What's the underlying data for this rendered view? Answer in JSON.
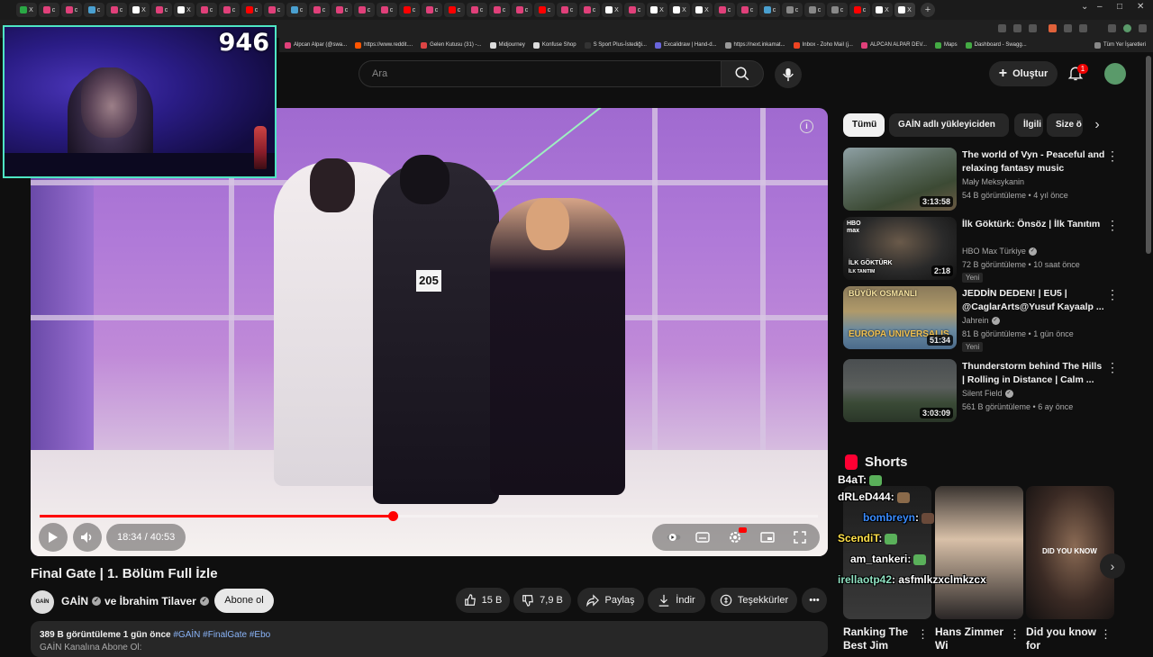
{
  "browser": {
    "tabs": [
      {
        "glyph": "X",
        "color": "#2aa845"
      },
      {
        "glyph": "c",
        "color": "#e0407a"
      },
      {
        "glyph": "c",
        "color": "#e0407a"
      },
      {
        "glyph": "c",
        "color": "#4aa0d0"
      },
      {
        "glyph": "c",
        "color": "#e0407a"
      },
      {
        "glyph": "X",
        "color": "#ffffff"
      },
      {
        "glyph": "c",
        "color": "#e0407a"
      },
      {
        "glyph": "X",
        "color": "#ffffff"
      },
      {
        "glyph": "c",
        "color": "#e0407a"
      },
      {
        "glyph": "c",
        "color": "#e0407a"
      },
      {
        "glyph": "c",
        "color": "#ff0000"
      },
      {
        "glyph": "c",
        "color": "#e0407a"
      },
      {
        "glyph": "c",
        "color": "#4aa0d0"
      },
      {
        "glyph": "c",
        "color": "#e0407a"
      },
      {
        "glyph": "c",
        "color": "#e0407a"
      },
      {
        "glyph": "c",
        "color": "#e0407a"
      },
      {
        "glyph": "c",
        "color": "#e0407a"
      },
      {
        "glyph": "c",
        "color": "#ff0000"
      },
      {
        "glyph": "c",
        "color": "#e0407a"
      },
      {
        "glyph": "c",
        "color": "#ff0000"
      },
      {
        "glyph": "c",
        "color": "#e0407a"
      },
      {
        "glyph": "c",
        "color": "#e0407a"
      },
      {
        "glyph": "c",
        "color": "#e0407a"
      },
      {
        "glyph": "c",
        "color": "#ff0000"
      },
      {
        "glyph": "c",
        "color": "#e0407a"
      },
      {
        "glyph": "c",
        "color": "#e0407a"
      },
      {
        "glyph": "X",
        "color": "#ffffff"
      },
      {
        "glyph": "c",
        "color": "#e0407a"
      },
      {
        "glyph": "X",
        "color": "#ffffff"
      },
      {
        "glyph": "X",
        "color": "#ffffff"
      },
      {
        "glyph": "X",
        "color": "#ffffff"
      },
      {
        "glyph": "c",
        "color": "#e0407a"
      },
      {
        "glyph": "c",
        "color": "#e0407a"
      },
      {
        "glyph": "c",
        "color": "#4aa0d0"
      },
      {
        "glyph": "c",
        "color": "#888888"
      },
      {
        "glyph": "c",
        "color": "#888888"
      },
      {
        "glyph": "c",
        "color": "#888888"
      },
      {
        "glyph": "c",
        "color": "#ff0000"
      },
      {
        "glyph": "X",
        "color": "#ffffff"
      },
      {
        "glyph": "X",
        "color": "#ffffff"
      }
    ],
    "bookmarks": [
      {
        "label": "Alpcan Alpar (@swa...",
        "color": "#e0407a"
      },
      {
        "label": "https://www.reddit....",
        "color": "#ff5500"
      },
      {
        "label": "Gelen Kutusu (31) -...",
        "color": "#d44"
      },
      {
        "label": "Midjourney",
        "color": "#ddd"
      },
      {
        "label": "Konfuse Shop",
        "color": "#ddd"
      },
      {
        "label": "S Sport Plus-İstediği...",
        "color": "#333"
      },
      {
        "label": "Excalidraw | Hand-d...",
        "color": "#6965db"
      },
      {
        "label": "https://next.inkamat...",
        "color": "#999"
      },
      {
        "label": "Inbox - Zoho Mail (j...",
        "color": "#e42"
      },
      {
        "label": "ALPCAN ALPAR DEV...",
        "color": "#e0407a"
      },
      {
        "label": "Maps",
        "color": "#4a4"
      },
      {
        "label": "Dashboard - Swagg...",
        "color": "#4a4"
      }
    ],
    "all_bookmarks": "Tüm Yer İşaretleri"
  },
  "webcam": {
    "counter": "946"
  },
  "header": {
    "search_placeholder": "Ara",
    "create_label": "Oluştur",
    "notif_count": "1"
  },
  "player": {
    "time": "18:34 / 40:53",
    "progress": 0.4537,
    "bib_number": "205"
  },
  "video": {
    "title": "Final Gate | 1. Bölüm Full İzle",
    "channel_avatar": "GAİN",
    "channel": "GAİN",
    "collab": "ve İbrahim Tilaver",
    "subscribe": "Abone ol",
    "likes": "15 B",
    "dislikes": "7,9 B",
    "share": "Paylaş",
    "download": "İndir",
    "thanks": "Teşekkürler",
    "views_date": "389 B görüntüleme  1 gün önce",
    "tags": "#GAİN #FinalGate #Ebo",
    "desc_line2": "GAİN Kanalına Abone Ol:"
  },
  "chips": [
    "Tümü",
    "GAİN adlı yükleyiciden",
    "İlgili",
    "Size ö"
  ],
  "recommendations": [
    {
      "title": "The world of Vyn - Peaceful and relaxing fantasy music (Enderal)",
      "channel": "Mały Meksykanin",
      "verified": false,
      "meta": "54 B görüntüleme • 4 yıl önce",
      "duration": "3:13:58",
      "new": "",
      "bg": "linear-gradient(160deg,#8ea0a4 0%,#5a6a5e 40%,#3c4a34 70%,#6a5a44 100%)"
    },
    {
      "title": "İlk Göktürk: Önsöz | İlk Tanıtım",
      "channel": "HBO Max Türkiye",
      "verified": true,
      "meta": "72 B görüntüleme • 10 saat önce",
      "duration": "2:18",
      "new": "Yeni",
      "bg": "radial-gradient(ellipse at 50% 40%,#6a5a4a 0%,#2a2a2a 55%,#111 100%)",
      "caption": "İLK GÖKTÜRK",
      "caption2": "İLK TANITIM"
    },
    {
      "title": "JEDDİN DEDEN! | EU5 | @CaglarArts@Yusuf Kayaalp ...",
      "channel": "Jahrein",
      "verified": true,
      "meta": "81 B görüntüleme • 1 gün önce",
      "duration": "51:34",
      "new": "Yeni",
      "bg": "linear-gradient(180deg,#8a7a5a 0%,#b09a6a 40%,#6a8aa0 70%,#4a6a8a 100%)",
      "caption": "BÜYÜK OSMANLI",
      "caption2": "EUROPA UNIVERSALIS"
    },
    {
      "title": "Thunderstorm behind The Hills | Rolling in Distance | Calm ...",
      "channel": "Silent Field",
      "verified": true,
      "meta": "561 B görüntüleme • 6 ay önce",
      "duration": "3:03:09",
      "new": "",
      "bg": "linear-gradient(180deg,#4a4e50 0%,#5a5e5c 45%,#3a4a36 70%,#2a3628 100%)"
    }
  ],
  "shorts": {
    "heading": "Shorts",
    "items": [
      {
        "title": "Ranking The Best Jim",
        "bg": "linear-gradient(180deg,#1c1c1c,#3a3a3a)"
      },
      {
        "title": "Hans Zimmer Wi",
        "bg": "linear-gradient(180deg,#3a3430 0%,#d8c0a8 40%,#2a2626 100%)"
      },
      {
        "title": "Did you know for",
        "bg": "radial-gradient(ellipse at 55% 45%,#8a6a54 0%,#3a2a24 55%,#121010 100%)",
        "overlay": "DID YOU KNOW"
      }
    ]
  },
  "chat": [
    {
      "user": "B4aT",
      "text": ":",
      "color": "#ffffff"
    },
    {
      "user": "dRLeD444",
      "text": ":",
      "color": "#ffffff"
    },
    {
      "user": "bombreyn",
      "text": ":",
      "color": "#3a8cff"
    },
    {
      "user": "ScendiT",
      "text": ":",
      "color": "#ffe14a"
    },
    {
      "user": "am_tankeri",
      "text": ":",
      "color": "#ffffff"
    },
    {
      "user": "irellaotp42",
      "text": ": asfmlkzxclmkzcx",
      "color": "#8ee0c0"
    }
  ]
}
